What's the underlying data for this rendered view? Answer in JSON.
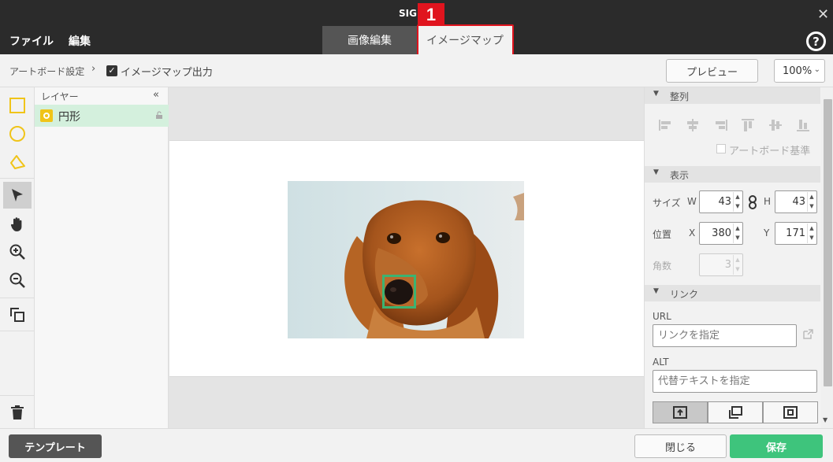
{
  "window": {
    "title": "SIGN",
    "close_glyph": "✕",
    "step_badge": "1",
    "help_glyph": "?"
  },
  "menu": {
    "file": "ファイル",
    "edit": "編集"
  },
  "tabs": {
    "image_edit": "画像編集",
    "image_map": "イメージマップ",
    "active": "image_map"
  },
  "toolbar": {
    "breadcrumb_artboard": "アートボード設定",
    "breadcrumb_sep": "›",
    "imagemap_output_checked": true,
    "imagemap_output_label": "イメージマップ出力",
    "preview_label": "プレビュー",
    "zoom_value": "100%"
  },
  "tools": [
    "rectangle-tool",
    "ellipse-tool",
    "polygon-tool",
    "select-tool",
    "hand-tool",
    "zoom-in-tool",
    "zoom-out-tool",
    "arrange-tool",
    "trash"
  ],
  "layers": {
    "header": "レイヤー",
    "collapse_glyph": "«",
    "items": [
      {
        "name": "円形",
        "type": "ellipse",
        "locked": false
      }
    ]
  },
  "properties": {
    "align": {
      "title": "整列",
      "artboard_base_label": "アートボード基準",
      "artboard_base_checked": false
    },
    "display": {
      "title": "表示",
      "size_label": "サイズ",
      "w_label": "W",
      "w_value": "43",
      "h_label": "H",
      "h_value": "43",
      "position_label": "位置",
      "x_label": "X",
      "x_value": "380",
      "y_label": "Y",
      "y_value": "171",
      "corners_label": "角数",
      "corners_value": "3"
    },
    "link": {
      "title": "リンク",
      "url_label": "URL",
      "url_placeholder": "リンクを指定",
      "alt_label": "ALT",
      "alt_placeholder": "代替テキストを指定"
    }
  },
  "footer": {
    "template_label": "テンプレート",
    "close_label": "閉じる",
    "save_label": "保存"
  },
  "colors": {
    "accent_green": "#3ec47c",
    "highlight_red": "#e0141e",
    "shape_yellow": "#f0c419",
    "selection_green": "#3cb371"
  }
}
